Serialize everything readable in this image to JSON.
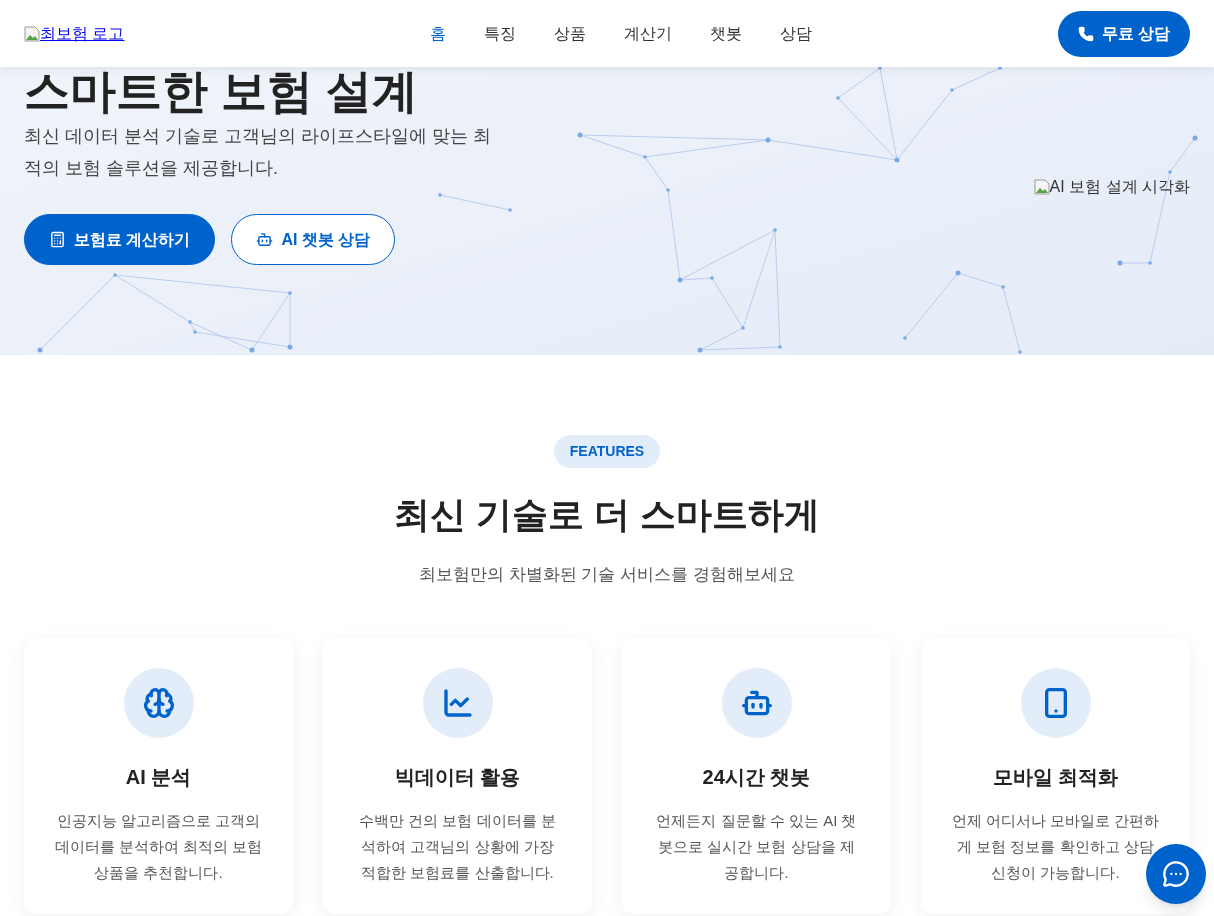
{
  "header": {
    "logo_alt": "최보험 로고",
    "nav": [
      {
        "label": "홈",
        "selected": true
      },
      {
        "label": "특징",
        "selected": false
      },
      {
        "label": "상품",
        "selected": false
      },
      {
        "label": "계산기",
        "selected": false
      },
      {
        "label": "챗봇",
        "selected": false
      },
      {
        "label": "상담",
        "selected": false
      }
    ],
    "cta": "무료 상담"
  },
  "hero": {
    "title_lines": [
      "스마트한 보험 설계"
    ],
    "subtitle": "최신 데이터 분석 기술로 고객님의 라이프스타일에 맞는 최적의 보험 솔루션을 제공합니다.",
    "buttons": [
      {
        "label": "보험료 계산하기",
        "kind": "primary"
      },
      {
        "label": "AI 챗봇 상담",
        "kind": "outline"
      }
    ],
    "image_alt": "AI 보험 설계 시각화"
  },
  "features": {
    "badge": "FEATURES",
    "title": "최신 기술로 더 스마트하게",
    "subtitle": "최보험만의 차별화된 기술 서비스를 경험해보세요",
    "cards": [
      {
        "title": "AI 분석",
        "description": "인공지능 알고리즘으로 고객의 데이터를 분석하여 최적의 보험 상품을 추천합니다."
      },
      {
        "title": "빅데이터 활용",
        "description": "수백만 건의 보험 데이터를 분석하여 고객님의 상황에 가장 적합한 보험료를 산출합니다."
      },
      {
        "title": "24시간 챗봇",
        "description": "언제든지 질문할 수 있는 AI 챗봇으로 실시간 보험 상담을 제공합니다."
      },
      {
        "title": "모바일 최적화",
        "description": "언제 어디서나 모바일로 간편하게 보험 정보를 확인하고 상담 신청이 가능합니다."
      }
    ]
  }
}
